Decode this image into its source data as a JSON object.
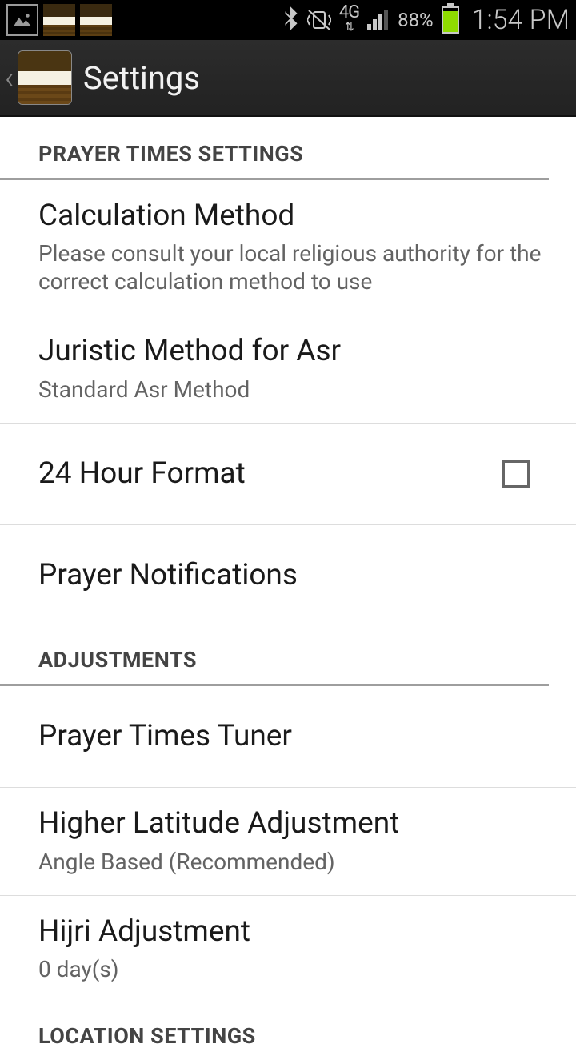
{
  "status": {
    "network": "4G",
    "battery_pct": "88%",
    "time": "1:54 PM"
  },
  "actionbar": {
    "title": "Settings"
  },
  "sections": {
    "prayer_times": {
      "header": "PRAYER TIMES SETTINGS",
      "calc_method": {
        "title": "Calculation Method",
        "sub": "Please consult your local religious authority for the correct calculation method to use"
      },
      "juristic": {
        "title": "Juristic Method for Asr",
        "sub": "Standard Asr Method"
      },
      "hour24": {
        "title": "24 Hour Format",
        "checked": false
      },
      "notifications": {
        "title": "Prayer Notifications"
      }
    },
    "adjustments": {
      "header": "ADJUSTMENTS",
      "tuner": {
        "title": "Prayer Times Tuner"
      },
      "higher_lat": {
        "title": "Higher Latitude Adjustment",
        "sub": "Angle Based (Recommended)"
      },
      "hijri": {
        "title": "Hijri Adjustment",
        "sub": "0 day(s)"
      }
    },
    "location": {
      "header": "LOCATION SETTINGS"
    }
  }
}
